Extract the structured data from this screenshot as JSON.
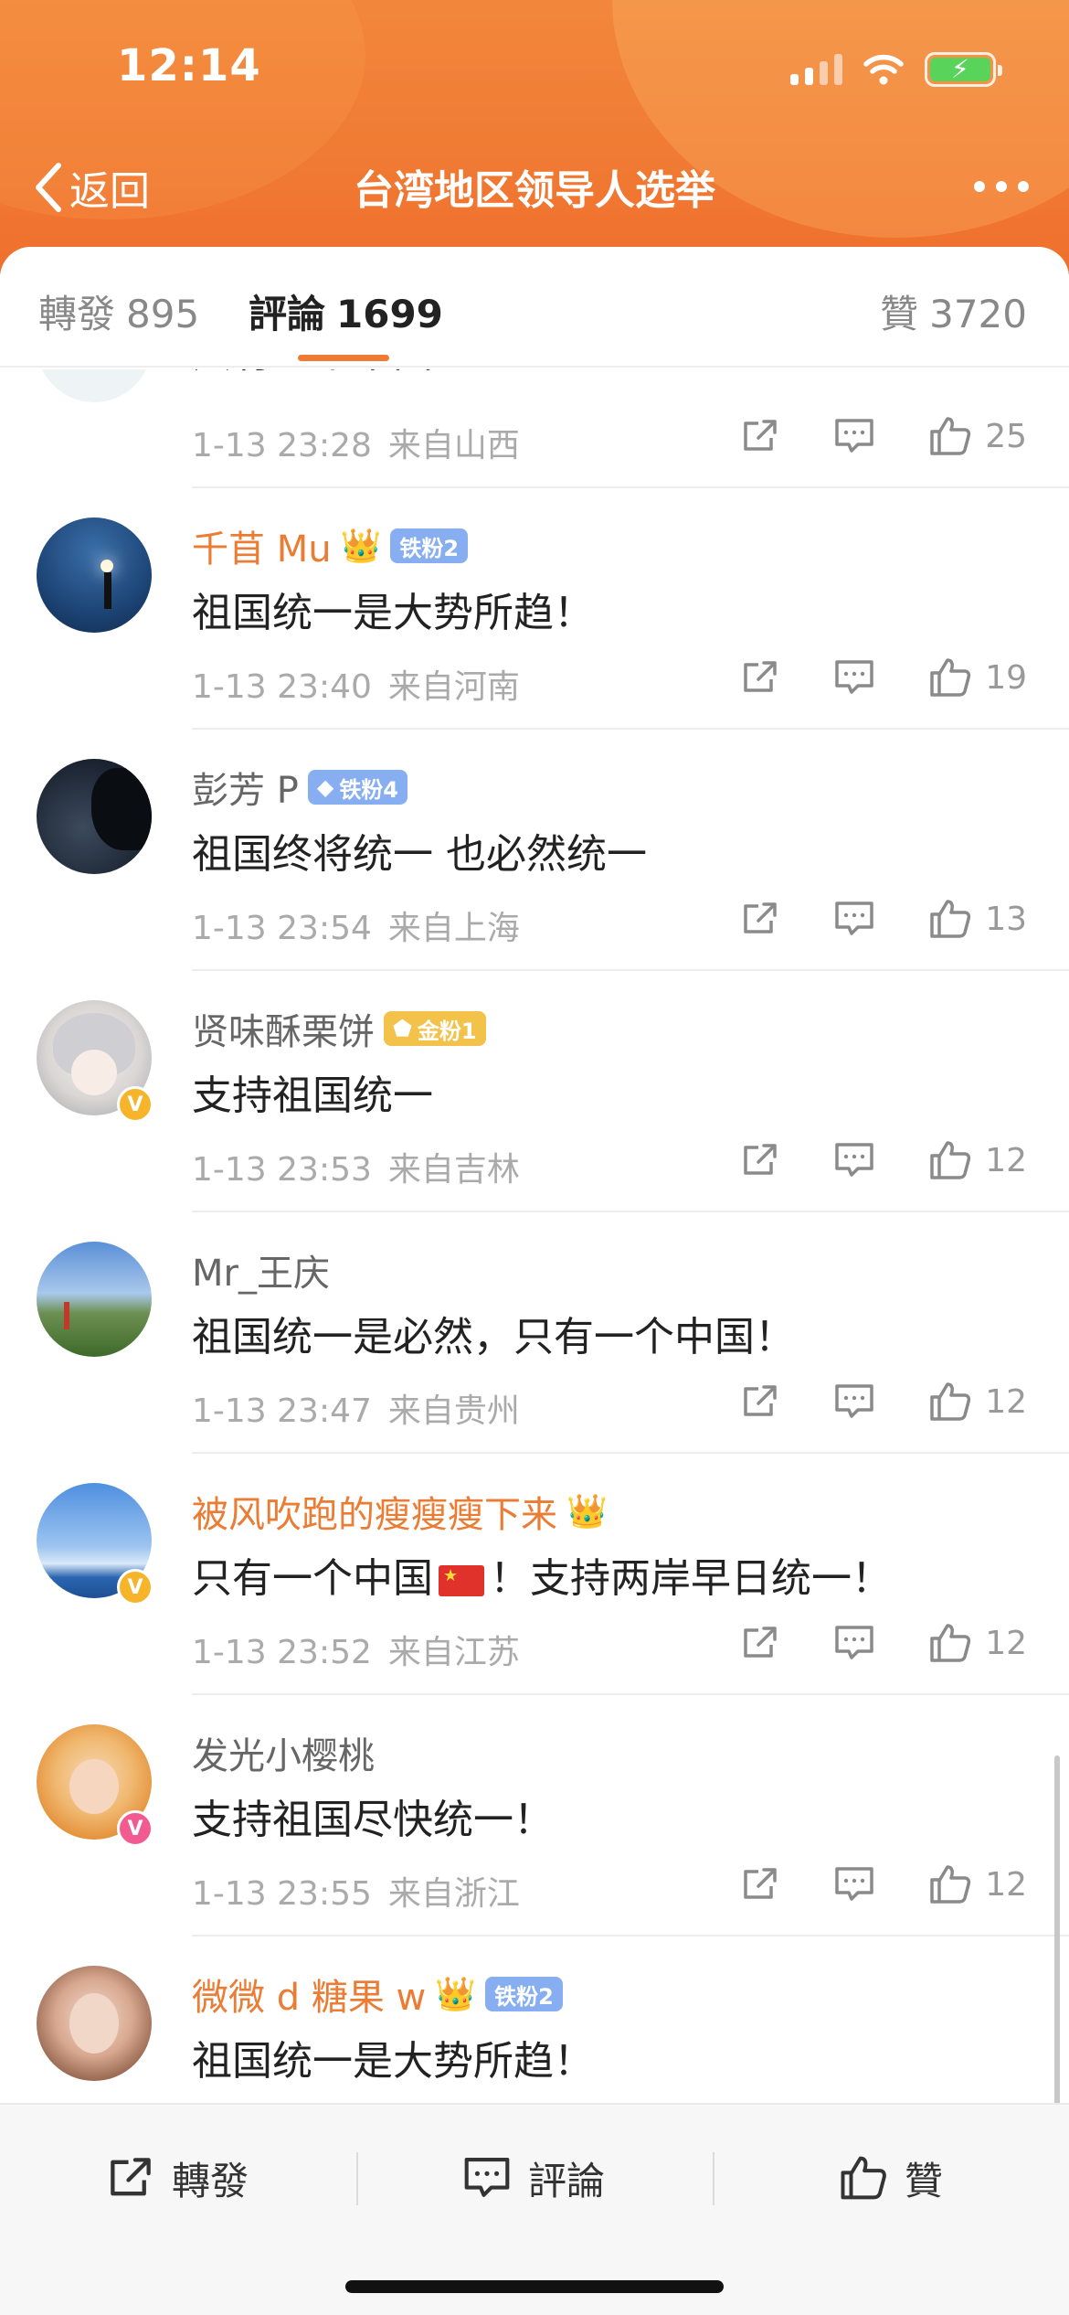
{
  "status_bar": {
    "time": "12:14"
  },
  "nav": {
    "back_label": "返回",
    "title": "台湾地区领导人选举"
  },
  "tabs": [
    {
      "label": "轉發",
      "count": "895"
    },
    {
      "label": "評論",
      "count": "1699"
    },
    {
      "label": "贊",
      "count": "3720"
    }
  ],
  "partial_comment": {
    "text": "只有一个中国",
    "time": "1-13 23:28",
    "location": "来自山西",
    "likes": "25"
  },
  "comments": [
    {
      "name": "千苜 Mu",
      "fan_badge": "铁粉2",
      "text": "祖国统一是大势所趋！",
      "time": "1-13 23:40",
      "location": "来自河南",
      "likes": "19"
    },
    {
      "name": "彭芳 P",
      "fan_badge": "铁粉4",
      "text": "祖国终将统一 也必然统一",
      "time": "1-13 23:54",
      "location": "来自上海",
      "likes": "13"
    },
    {
      "name": "贤味酥栗饼",
      "fan_badge": "金粉1",
      "text": "支持祖国统一",
      "time": "1-13 23:53",
      "location": "来自吉林",
      "likes": "12"
    },
    {
      "name": "Mr_王庆",
      "text": "祖国统一是必然，只有一个中国！",
      "time": "1-13 23:47",
      "location": "来自贵州",
      "likes": "12"
    },
    {
      "name": "被风吹跑的瘦瘦瘦下来",
      "text_before": "只有一个中国",
      "text_after": "！支持两岸早日统一！",
      "time": "1-13 23:52",
      "location": "来自江苏",
      "likes": "12"
    },
    {
      "name": "发光小樱桃",
      "text": "支持祖国尽快统一！",
      "time": "1-13 23:55",
      "location": "来自浙江",
      "likes": "12"
    },
    {
      "name": "微微 d 糖果 w",
      "fan_badge": "铁粉2",
      "text": "祖国统一是大势所趋！"
    }
  ],
  "bottom_bar": {
    "repost": "轉發",
    "comment": "評論",
    "like": "贊"
  },
  "colors": {
    "accent": "#f07a33",
    "name_orange": "#eb7c34",
    "fan_blue": "#86aef0",
    "fan_gold": "#f3c24a",
    "verified_gold": "#f5b42a",
    "verified_pink": "#f25b8f"
  }
}
